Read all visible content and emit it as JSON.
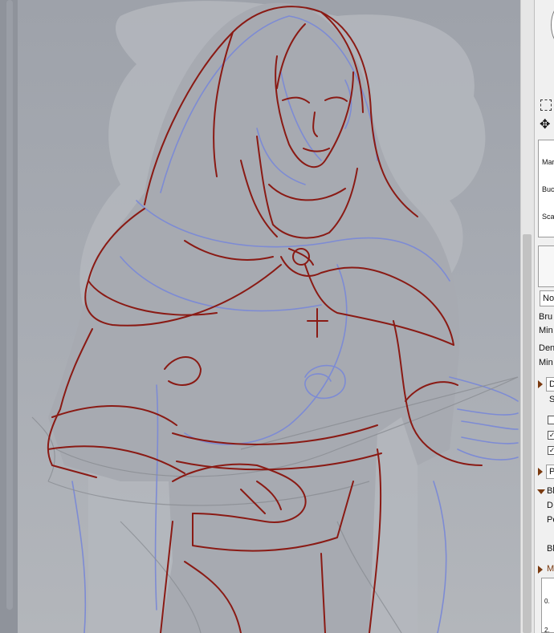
{
  "panel": {
    "fields": [
      {
        "label": "Mar"
      },
      {
        "label": "Buc"
      },
      {
        "label": "Sca"
      }
    ],
    "blend_value": "No",
    "brush_label": "Bru",
    "min_label_1": "Min",
    "density_label": "Den",
    "min_label_2": "Min",
    "section_d_label": "D",
    "s_label": "S",
    "section_p_label": "P",
    "section_bl_label": "Bl",
    "d_label": "D",
    "pe_label": "Pe",
    "bl_label": "Bl",
    "section_m_label": "M",
    "tick_value_1": "0.",
    "tick_value_2": "2."
  },
  "icons": {
    "select": "rect-select-icon",
    "move": "move-icon"
  },
  "colors": {
    "canvas_bg": "#a6a9b0",
    "line_red": "#8a1a14",
    "line_blue": "#7d8bd4",
    "panel_bg": "#f0f0f0",
    "section_arrow": "#7a3a10"
  }
}
